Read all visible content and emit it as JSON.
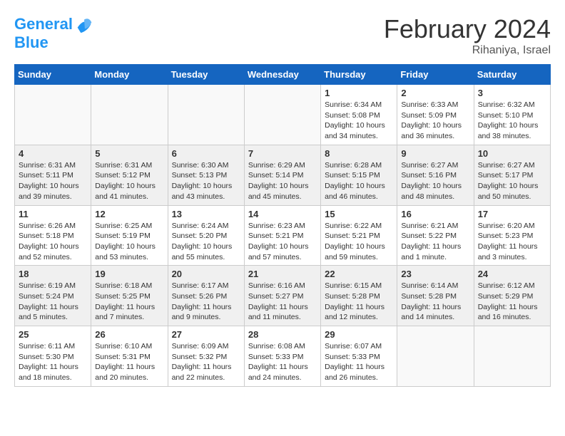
{
  "header": {
    "logo_line1": "General",
    "logo_line2": "Blue",
    "month_year": "February 2024",
    "location": "Rihaniya, Israel"
  },
  "days_of_week": [
    "Sunday",
    "Monday",
    "Tuesday",
    "Wednesday",
    "Thursday",
    "Friday",
    "Saturday"
  ],
  "weeks": [
    [
      {
        "num": "",
        "info": ""
      },
      {
        "num": "",
        "info": ""
      },
      {
        "num": "",
        "info": ""
      },
      {
        "num": "",
        "info": ""
      },
      {
        "num": "1",
        "info": "Sunrise: 6:34 AM\nSunset: 5:08 PM\nDaylight: 10 hours\nand 34 minutes."
      },
      {
        "num": "2",
        "info": "Sunrise: 6:33 AM\nSunset: 5:09 PM\nDaylight: 10 hours\nand 36 minutes."
      },
      {
        "num": "3",
        "info": "Sunrise: 6:32 AM\nSunset: 5:10 PM\nDaylight: 10 hours\nand 38 minutes."
      }
    ],
    [
      {
        "num": "4",
        "info": "Sunrise: 6:31 AM\nSunset: 5:11 PM\nDaylight: 10 hours\nand 39 minutes."
      },
      {
        "num": "5",
        "info": "Sunrise: 6:31 AM\nSunset: 5:12 PM\nDaylight: 10 hours\nand 41 minutes."
      },
      {
        "num": "6",
        "info": "Sunrise: 6:30 AM\nSunset: 5:13 PM\nDaylight: 10 hours\nand 43 minutes."
      },
      {
        "num": "7",
        "info": "Sunrise: 6:29 AM\nSunset: 5:14 PM\nDaylight: 10 hours\nand 45 minutes."
      },
      {
        "num": "8",
        "info": "Sunrise: 6:28 AM\nSunset: 5:15 PM\nDaylight: 10 hours\nand 46 minutes."
      },
      {
        "num": "9",
        "info": "Sunrise: 6:27 AM\nSunset: 5:16 PM\nDaylight: 10 hours\nand 48 minutes."
      },
      {
        "num": "10",
        "info": "Sunrise: 6:27 AM\nSunset: 5:17 PM\nDaylight: 10 hours\nand 50 minutes."
      }
    ],
    [
      {
        "num": "11",
        "info": "Sunrise: 6:26 AM\nSunset: 5:18 PM\nDaylight: 10 hours\nand 52 minutes."
      },
      {
        "num": "12",
        "info": "Sunrise: 6:25 AM\nSunset: 5:19 PM\nDaylight: 10 hours\nand 53 minutes."
      },
      {
        "num": "13",
        "info": "Sunrise: 6:24 AM\nSunset: 5:20 PM\nDaylight: 10 hours\nand 55 minutes."
      },
      {
        "num": "14",
        "info": "Sunrise: 6:23 AM\nSunset: 5:21 PM\nDaylight: 10 hours\nand 57 minutes."
      },
      {
        "num": "15",
        "info": "Sunrise: 6:22 AM\nSunset: 5:21 PM\nDaylight: 10 hours\nand 59 minutes."
      },
      {
        "num": "16",
        "info": "Sunrise: 6:21 AM\nSunset: 5:22 PM\nDaylight: 11 hours\nand 1 minute."
      },
      {
        "num": "17",
        "info": "Sunrise: 6:20 AM\nSunset: 5:23 PM\nDaylight: 11 hours\nand 3 minutes."
      }
    ],
    [
      {
        "num": "18",
        "info": "Sunrise: 6:19 AM\nSunset: 5:24 PM\nDaylight: 11 hours\nand 5 minutes."
      },
      {
        "num": "19",
        "info": "Sunrise: 6:18 AM\nSunset: 5:25 PM\nDaylight: 11 hours\nand 7 minutes."
      },
      {
        "num": "20",
        "info": "Sunrise: 6:17 AM\nSunset: 5:26 PM\nDaylight: 11 hours\nand 9 minutes."
      },
      {
        "num": "21",
        "info": "Sunrise: 6:16 AM\nSunset: 5:27 PM\nDaylight: 11 hours\nand 11 minutes."
      },
      {
        "num": "22",
        "info": "Sunrise: 6:15 AM\nSunset: 5:28 PM\nDaylight: 11 hours\nand 12 minutes."
      },
      {
        "num": "23",
        "info": "Sunrise: 6:14 AM\nSunset: 5:28 PM\nDaylight: 11 hours\nand 14 minutes."
      },
      {
        "num": "24",
        "info": "Sunrise: 6:12 AM\nSunset: 5:29 PM\nDaylight: 11 hours\nand 16 minutes."
      }
    ],
    [
      {
        "num": "25",
        "info": "Sunrise: 6:11 AM\nSunset: 5:30 PM\nDaylight: 11 hours\nand 18 minutes."
      },
      {
        "num": "26",
        "info": "Sunrise: 6:10 AM\nSunset: 5:31 PM\nDaylight: 11 hours\nand 20 minutes."
      },
      {
        "num": "27",
        "info": "Sunrise: 6:09 AM\nSunset: 5:32 PM\nDaylight: 11 hours\nand 22 minutes."
      },
      {
        "num": "28",
        "info": "Sunrise: 6:08 AM\nSunset: 5:33 PM\nDaylight: 11 hours\nand 24 minutes."
      },
      {
        "num": "29",
        "info": "Sunrise: 6:07 AM\nSunset: 5:33 PM\nDaylight: 11 hours\nand 26 minutes."
      },
      {
        "num": "",
        "info": ""
      },
      {
        "num": "",
        "info": ""
      }
    ]
  ]
}
